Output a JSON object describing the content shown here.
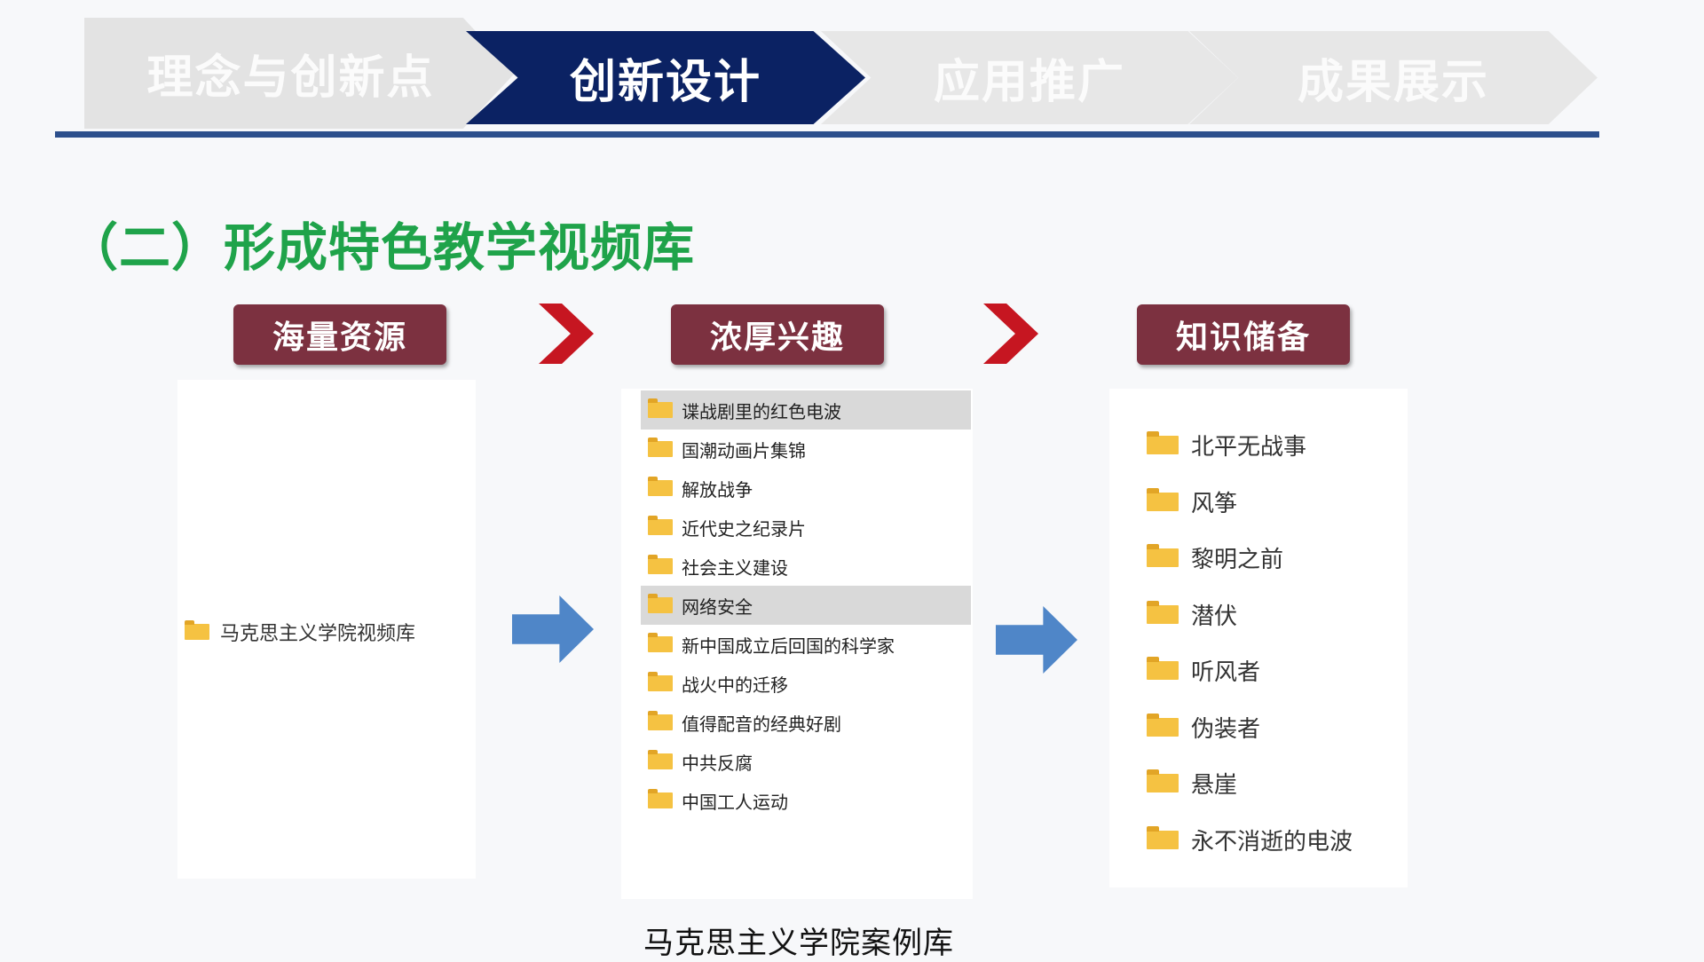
{
  "nav": {
    "steps": [
      {
        "label": "理念与创新点",
        "active": false
      },
      {
        "label": "创新设计",
        "active": true
      },
      {
        "label": "应用推广",
        "active": false
      },
      {
        "label": "成果展示",
        "active": false
      }
    ]
  },
  "section_title": "（二）形成特色教学视频库",
  "categories": [
    "海量资源",
    "浓厚兴趣",
    "知识储备"
  ],
  "panel1": {
    "root_folder": "马克思主义学院视频库"
  },
  "panel2": {
    "folders": [
      "谍战剧里的红色电波",
      "国潮动画片集锦",
      "解放战争",
      "近代史之纪录片",
      "社会主义建设",
      "网络安全",
      "新中国成立后回国的科学家",
      "战火中的迁移",
      "值得配音的经典好剧",
      "中共反腐",
      "中国工人运动"
    ],
    "selected": [
      "谍战剧里的红色电波",
      "网络安全"
    ]
  },
  "panel3": {
    "folders": [
      "北平无战事",
      "风筝",
      "黎明之前",
      "潜伏",
      "听风者",
      "伪装者",
      "悬崖",
      "永不消逝的电波"
    ]
  },
  "caption": "马克思主义学院案例库",
  "colors": {
    "nav_active": "#0b2263",
    "nav_inactive": "#e3e3e3",
    "nav_line": "#2c4f8c",
    "title_green": "#1fa34a",
    "category_bg": "#7c3140",
    "chevron_red": "#c61621",
    "arrow_blue": "#4f86c8",
    "folder_yellow": "#f5c242"
  },
  "icons": [
    "folder-icon",
    "chevron-right-icon",
    "arrow-right-icon"
  ]
}
